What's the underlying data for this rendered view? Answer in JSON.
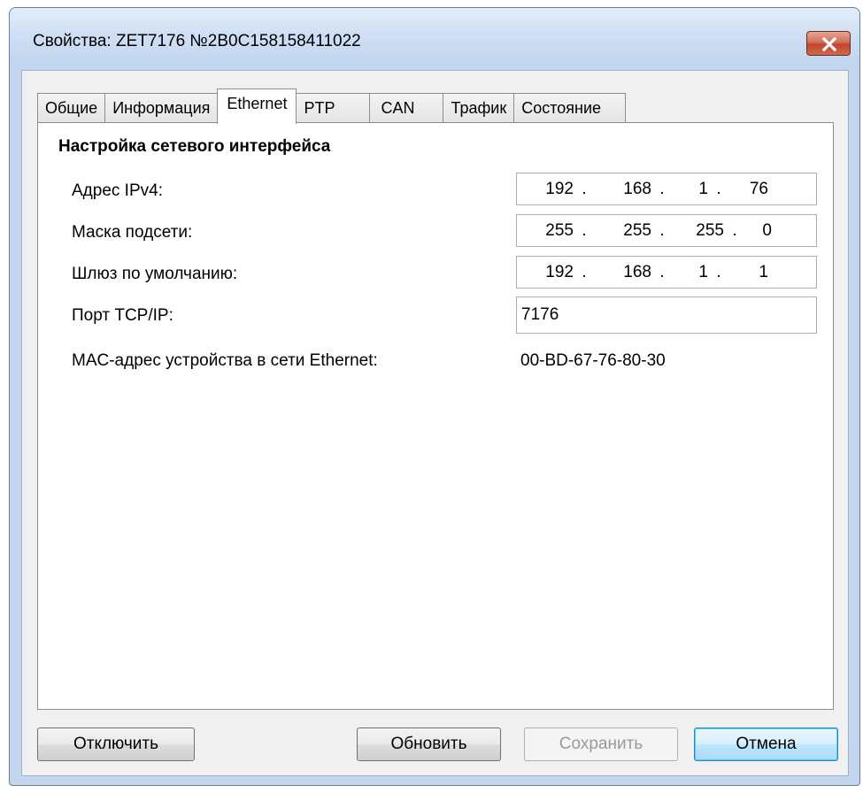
{
  "window": {
    "title": "Свойства: ZET7176 №2B0C158158411022"
  },
  "tabs": [
    {
      "label": "Общие",
      "active": false
    },
    {
      "label": "Информация",
      "active": false
    },
    {
      "label": "Ethernet",
      "active": true
    },
    {
      "label": "PTP",
      "active": false
    },
    {
      "label": "CAN",
      "active": false
    },
    {
      "label": "Трафик",
      "active": false
    },
    {
      "label": "Состояние",
      "active": false
    }
  ],
  "panel": {
    "section_title": "Настройка сетевого интерфейса",
    "ipv4": {
      "label": "Адрес IPv4:",
      "octets": [
        "192",
        "168",
        "1",
        "76"
      ]
    },
    "mask": {
      "label": "Маска подсети:",
      "octets": [
        "255",
        "255",
        "255",
        "0"
      ]
    },
    "gateway": {
      "label": "Шлюз по умолчанию:",
      "octets": [
        "192",
        "168",
        "1",
        "1"
      ]
    },
    "port": {
      "label": "Порт TCP/IP:",
      "value": "7176"
    },
    "mac": {
      "label": "MAC-адрес устройства в сети Ethernet:",
      "value": "00-BD-67-76-80-30"
    }
  },
  "buttons": {
    "disconnect": "Отключить",
    "refresh": "Обновить",
    "save": "Сохранить",
    "cancel": "Отмена"
  },
  "icons": {
    "close": "close-icon"
  },
  "colors": {
    "close_button": "#c0462f",
    "title_bar": "#cfdff4",
    "default_button": "#3c7fb1"
  }
}
